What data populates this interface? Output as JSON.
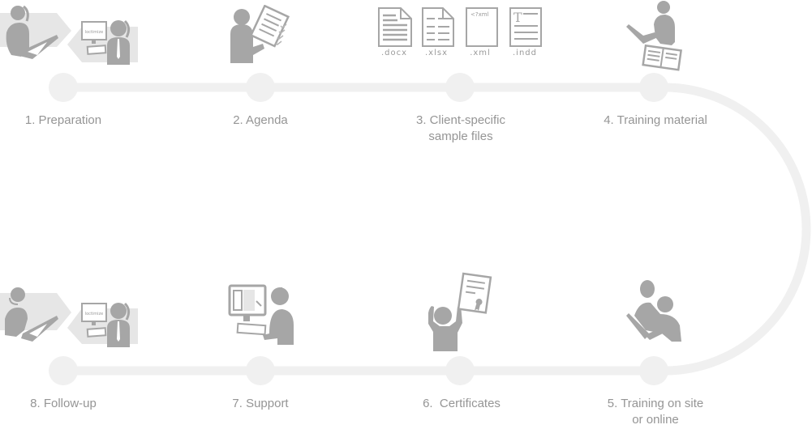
{
  "diagram": {
    "type": "process-timeline",
    "colors": {
      "track": "#f0f0f0",
      "icon": "#a6a6a6",
      "banner": "#e6e6e6",
      "text": "#959595"
    },
    "steps": [
      {
        "id": 1,
        "label": "1. Preparation",
        "icon": "consultation-call-icon",
        "screen_text": "loctimize"
      },
      {
        "id": 2,
        "label": "2. Agenda",
        "icon": "agenda-checklist-icon"
      },
      {
        "id": 3,
        "label_lines": [
          "3. Client-specific",
          "sample files"
        ],
        "icon": "sample-files-icon",
        "files": [
          {
            "ext": ".docx",
            "icon": "docx-file-icon"
          },
          {
            "ext": ".xlsx",
            "icon": "xlsx-file-icon"
          },
          {
            "ext": ".xml",
            "icon": "xml-file-icon",
            "snippet": "<?xml"
          },
          {
            "ext": ".indd",
            "icon": "indd-file-icon",
            "glyph": "T"
          }
        ]
      },
      {
        "id": 4,
        "label": "4. Training material",
        "icon": "training-material-icon"
      },
      {
        "id": 5,
        "label_lines": [
          "5. Training on site",
          "or online"
        ],
        "icon": "training-on-site-icon"
      },
      {
        "id": 6,
        "label": "6.  Certificates",
        "icon": "certificate-icon"
      },
      {
        "id": 7,
        "label": "7. Support",
        "icon": "support-headset-icon"
      },
      {
        "id": 8,
        "label": "8. Follow-up",
        "icon": "follow-up-call-icon",
        "screen_text": "loctimize"
      }
    ]
  }
}
